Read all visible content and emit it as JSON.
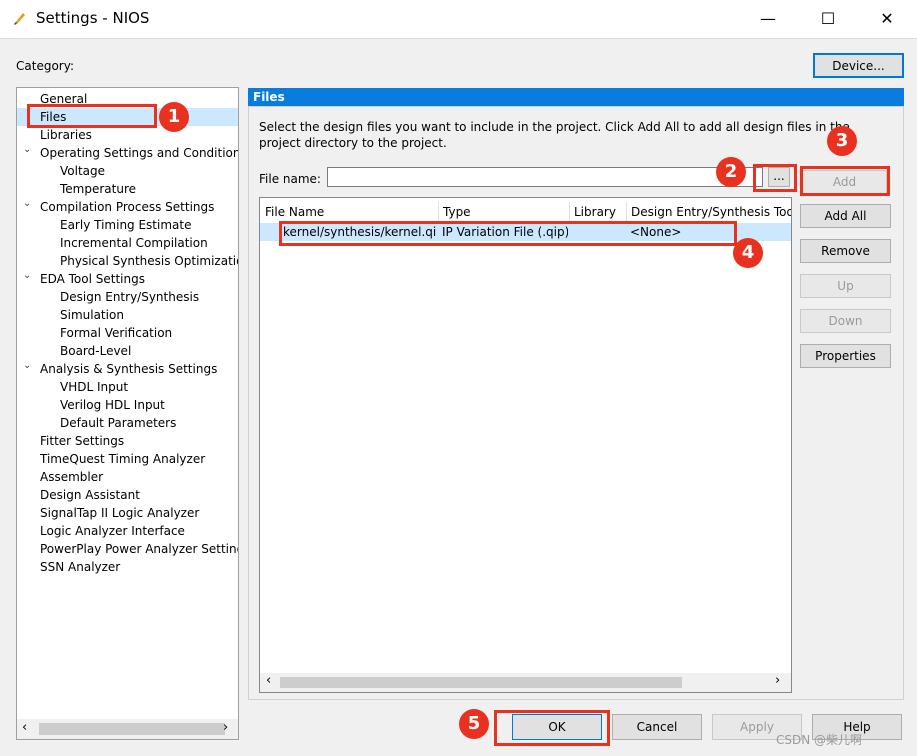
{
  "window": {
    "title": "Settings - NIOS",
    "minimize": "—",
    "maximize": "☐",
    "close": "✕"
  },
  "dialog": {
    "category_label": "Category:",
    "device_button": "Device..."
  },
  "tree": [
    {
      "label": "General",
      "level": 1,
      "expander": ""
    },
    {
      "label": "Files",
      "level": 1,
      "expander": "",
      "selected": true
    },
    {
      "label": "Libraries",
      "level": 1,
      "expander": ""
    },
    {
      "label": "Operating Settings and Conditions",
      "level": 1,
      "expander": "⌄"
    },
    {
      "label": "Voltage",
      "level": 2,
      "expander": ""
    },
    {
      "label": "Temperature",
      "level": 2,
      "expander": ""
    },
    {
      "label": "Compilation Process Settings",
      "level": 1,
      "expander": "⌄"
    },
    {
      "label": "Early Timing Estimate",
      "level": 2,
      "expander": ""
    },
    {
      "label": "Incremental Compilation",
      "level": 2,
      "expander": ""
    },
    {
      "label": "Physical Synthesis Optimizations",
      "level": 2,
      "expander": ""
    },
    {
      "label": "EDA Tool Settings",
      "level": 1,
      "expander": "⌄"
    },
    {
      "label": "Design Entry/Synthesis",
      "level": 2,
      "expander": ""
    },
    {
      "label": "Simulation",
      "level": 2,
      "expander": ""
    },
    {
      "label": "Formal Verification",
      "level": 2,
      "expander": ""
    },
    {
      "label": "Board-Level",
      "level": 2,
      "expander": ""
    },
    {
      "label": "Analysis & Synthesis Settings",
      "level": 1,
      "expander": "⌄"
    },
    {
      "label": "VHDL Input",
      "level": 2,
      "expander": ""
    },
    {
      "label": "Verilog HDL Input",
      "level": 2,
      "expander": ""
    },
    {
      "label": "Default Parameters",
      "level": 2,
      "expander": ""
    },
    {
      "label": "Fitter Settings",
      "level": 1,
      "expander": ""
    },
    {
      "label": "TimeQuest Timing Analyzer",
      "level": 1,
      "expander": ""
    },
    {
      "label": "Assembler",
      "level": 1,
      "expander": ""
    },
    {
      "label": "Design Assistant",
      "level": 1,
      "expander": ""
    },
    {
      "label": "SignalTap II Logic Analyzer",
      "level": 1,
      "expander": ""
    },
    {
      "label": "Logic Analyzer Interface",
      "level": 1,
      "expander": ""
    },
    {
      "label": "PowerPlay Power Analyzer Settings",
      "level": 1,
      "expander": ""
    },
    {
      "label": "SSN Analyzer",
      "level": 1,
      "expander": ""
    }
  ],
  "files_panel": {
    "header": "Files",
    "description": "Select the design files you want to include in the project. Click Add All to add all design files in the project directory to the project.",
    "file_name_label": "File name:",
    "file_name_value": "",
    "browse_button": "...",
    "columns": [
      "File Name",
      "Type",
      "Library",
      "Design Entry/Synthesis Tool"
    ],
    "rows": [
      {
        "file": "kernel/synthesis/kernel.qip",
        "type": "IP Variation File (.qip)",
        "library": "",
        "tool": "<None>"
      }
    ],
    "buttons": {
      "add": "Add",
      "add_all": "Add All",
      "remove": "Remove",
      "up": "Up",
      "down": "Down",
      "properties": "Properties"
    }
  },
  "footer": {
    "ok": "OK",
    "cancel": "Cancel",
    "apply": "Apply",
    "help": "Help"
  },
  "annotations": [
    "1",
    "2",
    "3",
    "4",
    "5"
  ],
  "watermark": "CSDN @柴儿啊",
  "colors": {
    "annotation": "#e8321f",
    "header": "#0a7cde",
    "selection": "#cce8ff"
  }
}
